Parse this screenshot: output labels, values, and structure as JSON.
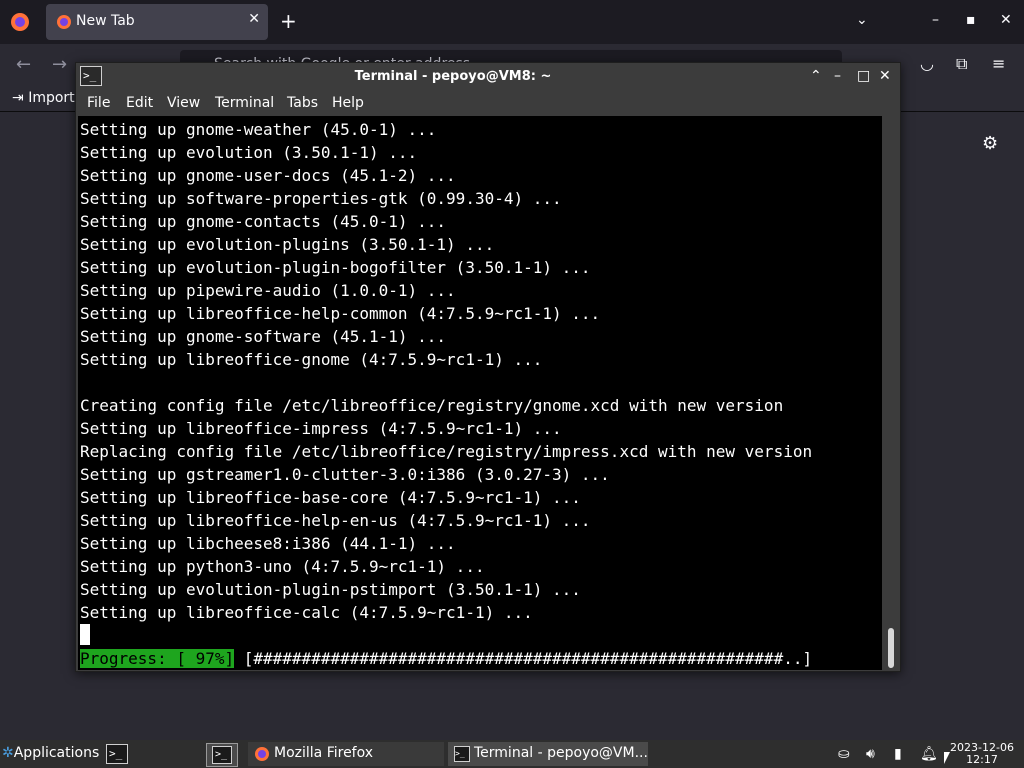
{
  "firefox": {
    "tab_title": "New Tab",
    "urlbar_placeholder": "Search with Google or enter address",
    "bookmark_import": "Import"
  },
  "terminal": {
    "title": "Terminal - pepoyo@VM8: ~",
    "menu": [
      "File",
      "Edit",
      "View",
      "Terminal",
      "Tabs",
      "Help"
    ],
    "lines": [
      "Setting up gnome-weather (45.0-1) ...",
      "Setting up evolution (3.50.1-1) ...",
      "Setting up gnome-user-docs (45.1-2) ...",
      "Setting up software-properties-gtk (0.99.30-4) ...",
      "Setting up gnome-contacts (45.0-1) ...",
      "Setting up evolution-plugins (3.50.1-1) ...",
      "Setting up evolution-plugin-bogofilter (3.50.1-1) ...",
      "Setting up pipewire-audio (1.0.0-1) ...",
      "Setting up libreoffice-help-common (4:7.5.9~rc1-1) ...",
      "Setting up gnome-software (45.1-1) ...",
      "Setting up libreoffice-gnome (4:7.5.9~rc1-1) ...",
      "",
      "Creating config file /etc/libreoffice/registry/gnome.xcd with new version",
      "Setting up libreoffice-impress (4:7.5.9~rc1-1) ...",
      "Replacing config file /etc/libreoffice/registry/impress.xcd with new version",
      "Setting up gstreamer1.0-clutter-3.0:i386 (3.0.27-3) ...",
      "Setting up libreoffice-base-core (4:7.5.9~rc1-1) ...",
      "Setting up libreoffice-help-en-us (4:7.5.9~rc1-1) ...",
      "Setting up libcheese8:i386 (44.1-1) ...",
      "Setting up python3-uno (4:7.5.9~rc1-1) ...",
      "Setting up evolution-plugin-pstimport (3.50.1-1) ...",
      "Setting up libreoffice-calc (4:7.5.9~rc1-1) ..."
    ],
    "progress_label": "Progress: [ 97%]",
    "progress_bar": " [#######################################################..]",
    "progress_percent": 97
  },
  "taskbar": {
    "applications": "Applications",
    "tasks": [
      "Mozilla Firefox",
      "Terminal - pepoyo@VM..."
    ],
    "clock_date": "2023-12-06",
    "clock_time": "12:17"
  },
  "colors": {
    "progress_label_bg": "#1ea51e",
    "terminal_bg": "#000000",
    "firefox_bg": "#2b2a33"
  }
}
